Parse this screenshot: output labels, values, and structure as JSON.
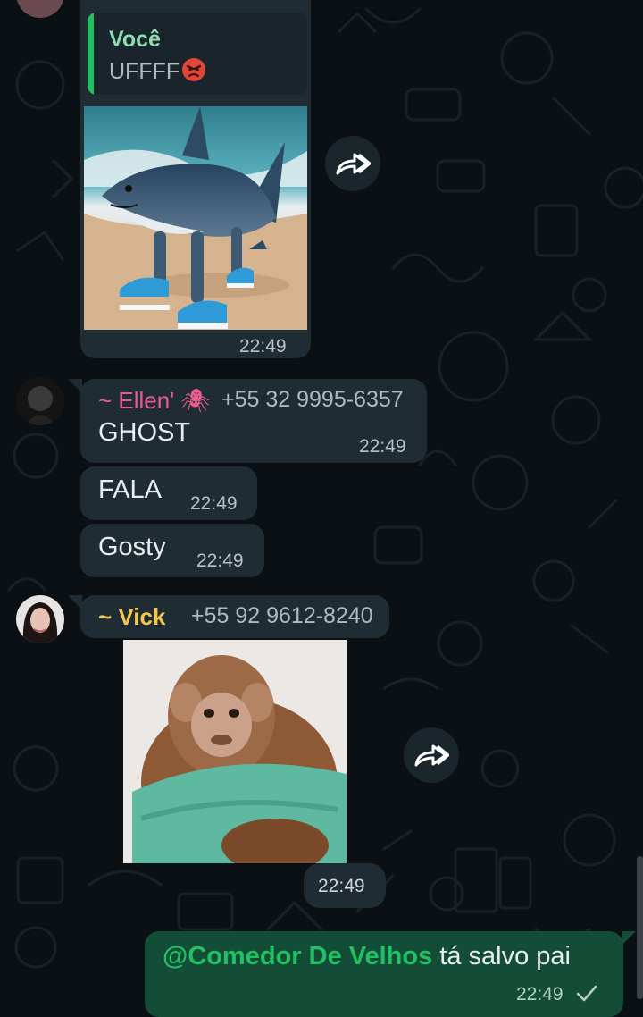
{
  "messages": {
    "reply_card": {
      "quote_author": "Você",
      "quote_text": "UFFFF",
      "quote_emoji": "angry-face-icon",
      "image_desc": "shark-in-sneakers",
      "time": "22:49"
    },
    "ellen": {
      "name": "~ Ellen' 🕷",
      "name_color": "#e85c8f",
      "phone": "+55 32 9995-6357",
      "text": "GHOST",
      "time": "22:49"
    },
    "fala": {
      "text": "FALA",
      "time": "22:49"
    },
    "gosty": {
      "text": "Gosty",
      "time": "22:49"
    },
    "vick": {
      "name": "~ Vick",
      "name_color": "#f5c64e",
      "phone": "+55 92 9612-8240",
      "sticker": "monkey-sticker",
      "time": "22:49"
    },
    "outgoing": {
      "mention": "@Comedor De Velhos",
      "text": "tá salvo pai",
      "time": "22:49",
      "status_icon": "check-icon"
    }
  },
  "colors": {
    "background": "#0b1014",
    "incoming_bubble": "#1f2c33",
    "outgoing_bubble": "#144d37",
    "accent_green": "#21c063"
  }
}
